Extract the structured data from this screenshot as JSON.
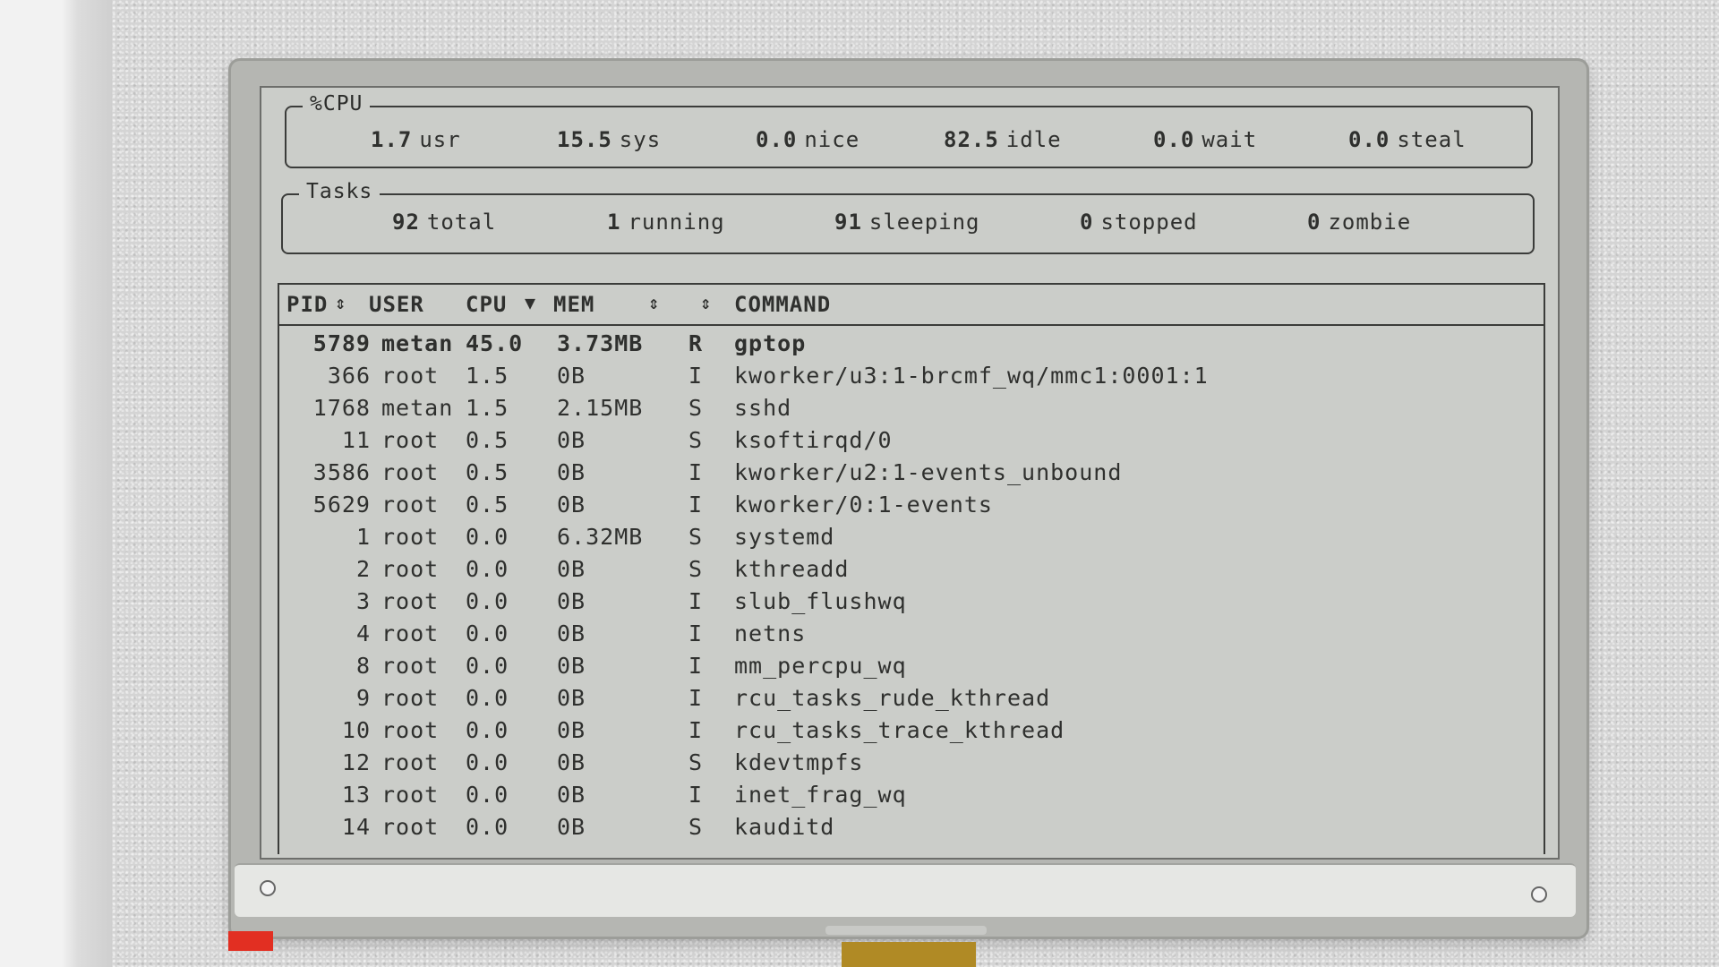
{
  "cpu": {
    "title": "%CPU",
    "stats": [
      {
        "value": "1.7",
        "label": "usr"
      },
      {
        "value": "15.5",
        "label": "sys"
      },
      {
        "value": "0.0",
        "label": "nice"
      },
      {
        "value": "82.5",
        "label": "idle"
      },
      {
        "value": "0.0",
        "label": "wait"
      },
      {
        "value": "0.0",
        "label": "steal"
      }
    ]
  },
  "tasks": {
    "title": "Tasks",
    "stats": [
      {
        "value": "92",
        "label": "total"
      },
      {
        "value": "1",
        "label": "running"
      },
      {
        "value": "91",
        "label": "sleeping"
      },
      {
        "value": "0",
        "label": "stopped"
      },
      {
        "value": "0",
        "label": "zombie"
      }
    ]
  },
  "table": {
    "headers": {
      "pid": "PID",
      "user": "USER",
      "cpu": "CPU",
      "mem": "MEM",
      "command": "COMMAND"
    },
    "rows": [
      {
        "pid": "5789",
        "user": "metan",
        "cpu": "45.0",
        "mem": "3.73MB",
        "state": "R",
        "command": "gptop"
      },
      {
        "pid": "366",
        "user": "root",
        "cpu": "1.5",
        "mem": "0B",
        "state": "I",
        "command": "kworker/u3:1-brcmf_wq/mmc1:0001:1"
      },
      {
        "pid": "1768",
        "user": "metan",
        "cpu": "1.5",
        "mem": "2.15MB",
        "state": "S",
        "command": "sshd"
      },
      {
        "pid": "11",
        "user": "root",
        "cpu": "0.5",
        "mem": "0B",
        "state": "S",
        "command": "ksoftirqd/0"
      },
      {
        "pid": "3586",
        "user": "root",
        "cpu": "0.5",
        "mem": "0B",
        "state": "I",
        "command": "kworker/u2:1-events_unbound"
      },
      {
        "pid": "5629",
        "user": "root",
        "cpu": "0.5",
        "mem": "0B",
        "state": "I",
        "command": "kworker/0:1-events"
      },
      {
        "pid": "1",
        "user": "root",
        "cpu": "0.0",
        "mem": "6.32MB",
        "state": "S",
        "command": "systemd"
      },
      {
        "pid": "2",
        "user": "root",
        "cpu": "0.0",
        "mem": "0B",
        "state": "S",
        "command": "kthreadd"
      },
      {
        "pid": "3",
        "user": "root",
        "cpu": "0.0",
        "mem": "0B",
        "state": "I",
        "command": "slub_flushwq"
      },
      {
        "pid": "4",
        "user": "root",
        "cpu": "0.0",
        "mem": "0B",
        "state": "I",
        "command": "netns"
      },
      {
        "pid": "8",
        "user": "root",
        "cpu": "0.0",
        "mem": "0B",
        "state": "I",
        "command": "mm_percpu_wq"
      },
      {
        "pid": "9",
        "user": "root",
        "cpu": "0.0",
        "mem": "0B",
        "state": "I",
        "command": "rcu_tasks_rude_kthread"
      },
      {
        "pid": "10",
        "user": "root",
        "cpu": "0.0",
        "mem": "0B",
        "state": "I",
        "command": "rcu_tasks_trace_kthread"
      },
      {
        "pid": "12",
        "user": "root",
        "cpu": "0.0",
        "mem": "0B",
        "state": "S",
        "command": "kdevtmpfs"
      },
      {
        "pid": "13",
        "user": "root",
        "cpu": "0.0",
        "mem": "0B",
        "state": "I",
        "command": "inet_frag_wq"
      },
      {
        "pid": "14",
        "user": "root",
        "cpu": "0.0",
        "mem": "0B",
        "state": "S",
        "command": "kauditd"
      }
    ]
  }
}
